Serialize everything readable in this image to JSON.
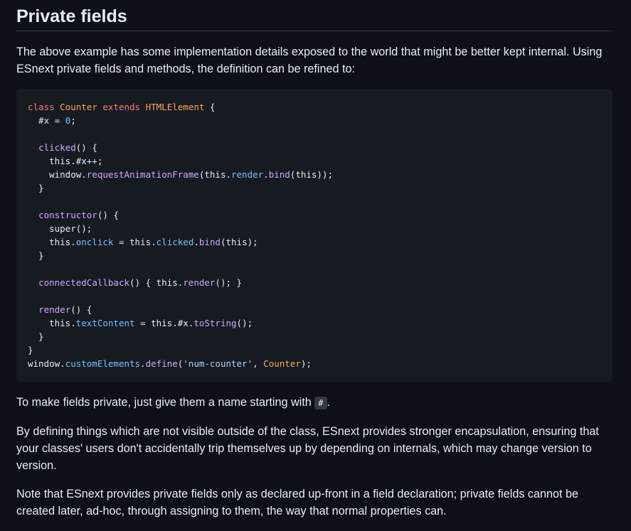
{
  "heading": "Private fields",
  "intro": "The above example has some implementation details exposed to the world that might be better kept internal. Using ESnext private fields and methods, the definition can be refined to:",
  "code": {
    "lines": [
      [
        [
          "kw",
          "class"
        ],
        [
          "t",
          " "
        ],
        [
          "ent",
          "Counter"
        ],
        [
          "t",
          " "
        ],
        [
          "kw",
          "extends"
        ],
        [
          "t",
          " "
        ],
        [
          "ent",
          "HTMLElement"
        ],
        [
          "t",
          " {"
        ]
      ],
      [
        [
          "t",
          "  #x = "
        ],
        [
          "c1",
          "0"
        ],
        [
          "t",
          ";"
        ]
      ],
      [],
      [
        [
          "t",
          "  "
        ],
        [
          "en",
          "clicked"
        ],
        [
          "t",
          "() {"
        ]
      ],
      [
        [
          "t",
          "    this.#x++;"
        ]
      ],
      [
        [
          "t",
          "    window."
        ],
        [
          "en",
          "requestAnimationFrame"
        ],
        [
          "t",
          "(this."
        ],
        [
          "c1",
          "render"
        ],
        [
          "t",
          "."
        ],
        [
          "en",
          "bind"
        ],
        [
          "t",
          "(this));"
        ]
      ],
      [
        [
          "t",
          "  }"
        ]
      ],
      [],
      [
        [
          "t",
          "  "
        ],
        [
          "en",
          "constructor"
        ],
        [
          "t",
          "() {"
        ]
      ],
      [
        [
          "t",
          "    super();"
        ]
      ],
      [
        [
          "t",
          "    this."
        ],
        [
          "c1",
          "onclick"
        ],
        [
          "t",
          " = this."
        ],
        [
          "c1",
          "clicked"
        ],
        [
          "t",
          "."
        ],
        [
          "en",
          "bind"
        ],
        [
          "t",
          "(this);"
        ]
      ],
      [
        [
          "t",
          "  }"
        ]
      ],
      [],
      [
        [
          "t",
          "  "
        ],
        [
          "en",
          "connectedCallback"
        ],
        [
          "t",
          "() { this."
        ],
        [
          "en",
          "render"
        ],
        [
          "t",
          "(); }"
        ]
      ],
      [],
      [
        [
          "t",
          "  "
        ],
        [
          "en",
          "render"
        ],
        [
          "t",
          "() {"
        ]
      ],
      [
        [
          "t",
          "    this."
        ],
        [
          "c1",
          "textContent"
        ],
        [
          "t",
          " = this.#x."
        ],
        [
          "en",
          "toString"
        ],
        [
          "t",
          "();"
        ]
      ],
      [
        [
          "t",
          "  }"
        ]
      ],
      [
        [
          "t",
          "}"
        ]
      ],
      [
        [
          "t",
          "window."
        ],
        [
          "c1",
          "customElements"
        ],
        [
          "t",
          "."
        ],
        [
          "en",
          "define"
        ],
        [
          "t",
          "("
        ],
        [
          "s",
          "'num-counter'"
        ],
        [
          "t",
          ", "
        ],
        [
          "ent",
          "Counter"
        ],
        [
          "t",
          ");"
        ]
      ]
    ]
  },
  "private_note": {
    "before": "To make fields private, just give them a name starting with ",
    "code": "#",
    "after": "."
  },
  "encapsulation": "By defining things which are not visible outside of the class, ESnext provides stronger encapsulation, ensuring that your classes' users don't accidentally trip themselves up by depending on internals, which may change version to version.",
  "declaration_note": "Note that ESnext provides private fields only as declared up-front in a field declaration; private fields cannot be created later, ad-hoc, through assigning to them, the way that normal properties can."
}
